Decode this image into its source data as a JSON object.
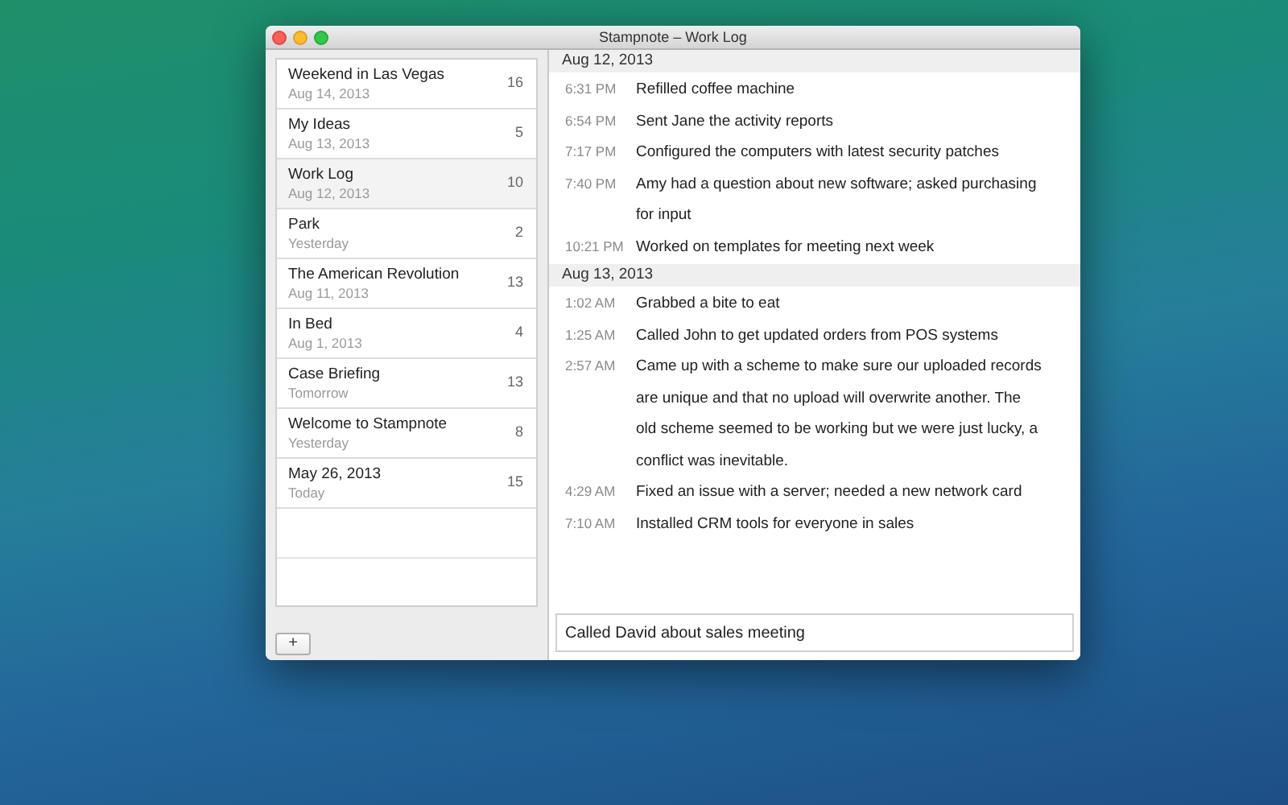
{
  "window": {
    "title": "Stampnote – Work Log"
  },
  "sidebar": {
    "notes": [
      {
        "title": "Weekend in Las Vegas",
        "date": "Aug 14, 2013",
        "count": "16",
        "selected": false
      },
      {
        "title": "My Ideas",
        "date": "Aug 13, 2013",
        "count": "5",
        "selected": false
      },
      {
        "title": "Work Log",
        "date": "Aug 12, 2013",
        "count": "10",
        "selected": true
      },
      {
        "title": "Park",
        "date": "Yesterday",
        "count": "2",
        "selected": false
      },
      {
        "title": "The American Revolution",
        "date": "Aug 11, 2013",
        "count": "13",
        "selected": false
      },
      {
        "title": "In Bed",
        "date": "Aug 1, 2013",
        "count": "4",
        "selected": false
      },
      {
        "title": "Case Briefing",
        "date": "Tomorrow",
        "count": "13",
        "selected": false
      },
      {
        "title": "Welcome to Stampnote",
        "date": "Yesterday",
        "count": "8",
        "selected": false
      },
      {
        "title": "May 26, 2013",
        "date": "Today",
        "count": "15",
        "selected": false
      }
    ],
    "add_button": "+"
  },
  "log": {
    "sections": [
      {
        "date": "Aug 12, 2013",
        "entries": [
          {
            "time": "6:31 PM",
            "text": "Refilled coffee machine"
          },
          {
            "time": "6:54 PM",
            "text": "Sent Jane the activity reports"
          },
          {
            "time": "7:17 PM",
            "text": "Configured the computers with latest security patches"
          },
          {
            "time": "7:40 PM",
            "text": "Amy had a question about new software; asked purchasing for input"
          },
          {
            "time": "10:21 PM",
            "text": "Worked on templates for meeting next week"
          }
        ]
      },
      {
        "date": "Aug 13, 2013",
        "entries": [
          {
            "time": "1:02 AM",
            "text": "Grabbed a bite to eat"
          },
          {
            "time": "1:25 AM",
            "text": "Called John to get updated orders from POS systems"
          },
          {
            "time": "2:57 AM",
            "text": "Came up with a scheme to make sure our uploaded records are unique and that no upload will overwrite another. The old scheme seemed to be working but we were just lucky, a conflict was inevitable."
          },
          {
            "time": "4:29 AM",
            "text": "Fixed an issue with a server; needed a new network card"
          },
          {
            "time": "7:10 AM",
            "text": "Installed CRM tools for everyone in sales"
          }
        ]
      }
    ]
  },
  "composer": {
    "value": "Called David about sales meeting"
  }
}
